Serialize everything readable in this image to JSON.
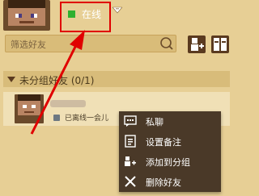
{
  "header": {
    "status_text": "在线",
    "status_color": "#2fb02f",
    "highlight_color": "#e00000"
  },
  "search": {
    "placeholder": "筛选好友"
  },
  "icons": {
    "search": "search-icon",
    "add_friend": "add-friend-icon",
    "grid": "grid-icon",
    "status_dropdown": "chevron-down-icon"
  },
  "group": {
    "label": "未分组好友 (0/1)"
  },
  "contact": {
    "status": "已离线一会儿"
  },
  "menu": {
    "items": [
      {
        "label": "私聊",
        "icon": "chat-icon"
      },
      {
        "label": "设置备注",
        "icon": "note-icon"
      },
      {
        "label": "添加到分组",
        "icon": "add-to-group-icon"
      },
      {
        "label": "删除好友",
        "icon": "delete-friend-icon"
      }
    ]
  }
}
